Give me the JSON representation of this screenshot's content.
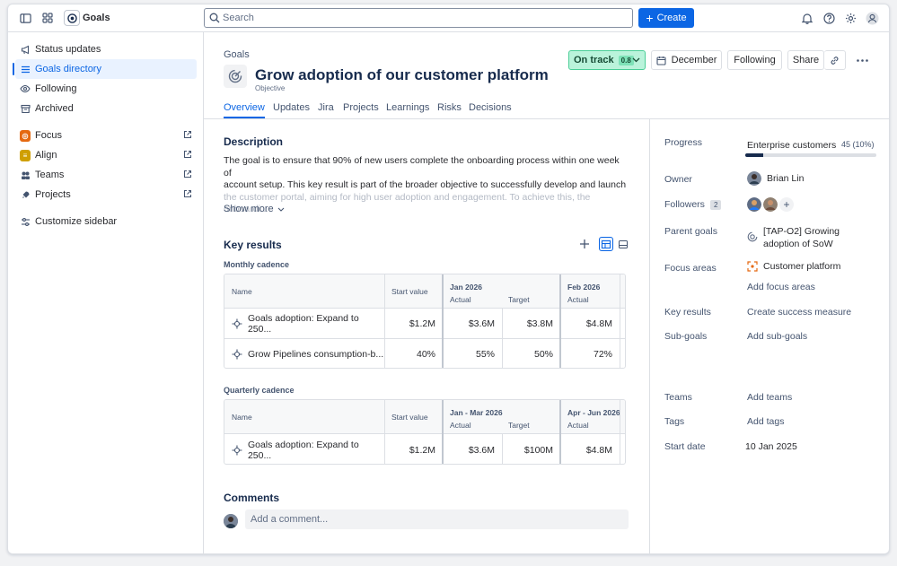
{
  "app": {
    "title": "Goals"
  },
  "search": {
    "placeholder": "Search"
  },
  "create": {
    "label": "Create"
  },
  "sidebar": {
    "items": [
      {
        "label": "Status updates"
      },
      {
        "label": "Goals directory"
      },
      {
        "label": "Following"
      },
      {
        "label": "Archived"
      }
    ],
    "apps": [
      {
        "label": "Focus",
        "color": "#e56910"
      },
      {
        "label": "Align",
        "color": "#cf9f02"
      },
      {
        "label": "Teams",
        "color": "#44546f"
      },
      {
        "label": "Projects",
        "color": "#44546f"
      }
    ],
    "customize": "Customize sidebar"
  },
  "goal": {
    "breadcrumb": "Goals",
    "title": "Grow adoption of our customer platform",
    "type": "Objective",
    "status": "On track",
    "score": "0.8",
    "target_month": "December",
    "following": "Following",
    "share": "Share"
  },
  "tabs": [
    "Overview",
    "Updates",
    "Jira",
    "Projects",
    "Learnings",
    "Risks",
    "Decisions"
  ],
  "description": {
    "heading": "Description",
    "line1": "The goal is to ensure that 90% of new users complete the onboarding process within one week of",
    "line2": "account setup. This key result is part of the broader objective to successfully develop and launch",
    "line3": "the customer portal, aiming for high user adoption and engagement. To achieve this, the onboardi...",
    "show_more": "Show more"
  },
  "key_results": {
    "heading": "Key results",
    "monthly": {
      "label": "Monthly cadence",
      "columns": {
        "name": "Name",
        "start": "Start value",
        "p1": "Jan 2026",
        "p1_actual": "Actual",
        "p1_target": "Target",
        "p2": "Feb 2026",
        "p2_actual": "Actual"
      },
      "rows": [
        {
          "name": "Goals adoption: Expand to 250...",
          "start": "$1.2M",
          "actual": "$3.6M",
          "target": "$3.8M",
          "next": "$4.8M"
        },
        {
          "name": "Grow Pipelines consumption-b...",
          "start": "40%",
          "actual": "55%",
          "target": "50%",
          "next": "72%"
        }
      ]
    },
    "quarterly": {
      "label": "Quarterly cadence",
      "columns": {
        "name": "Name",
        "start": "Start value",
        "p1": "Jan - Mar 2026",
        "p1_actual": "Actual",
        "p1_target": "Target",
        "p2": "Apr - Jun 2026",
        "p2_actual": "Actual"
      },
      "rows": [
        {
          "name": "Goals adoption: Expand to 250...",
          "start": "$1.2M",
          "actual": "$3.6M",
          "target": "$100M",
          "next": "$4.8M"
        }
      ]
    }
  },
  "comments": {
    "heading": "Comments",
    "placeholder": "Add a comment..."
  },
  "details": {
    "progress": {
      "label": "Progress",
      "name": "Enterprise customers",
      "value": "45 (10%)",
      "fraction": 0.14
    },
    "owner": {
      "label": "Owner",
      "value": "Brian Lin"
    },
    "followers": {
      "label": "Followers",
      "count": "2"
    },
    "parent_goals": {
      "label": "Parent goals",
      "line1": "[TAP-O2] Growing",
      "line2": "adoption of SoW"
    },
    "focus_areas": {
      "label": "Focus areas",
      "value": "Customer platform",
      "add": "Add focus areas"
    },
    "key_results": {
      "label": "Key results",
      "value": "Create success measure"
    },
    "sub_goals": {
      "label": "Sub-goals",
      "value": "Add sub-goals"
    },
    "teams": {
      "label": "Teams",
      "value": "Add teams"
    },
    "tags": {
      "label": "Tags",
      "value": "Add tags"
    },
    "start_date": {
      "label": "Start date",
      "value": "10 Jan 2025"
    }
  }
}
